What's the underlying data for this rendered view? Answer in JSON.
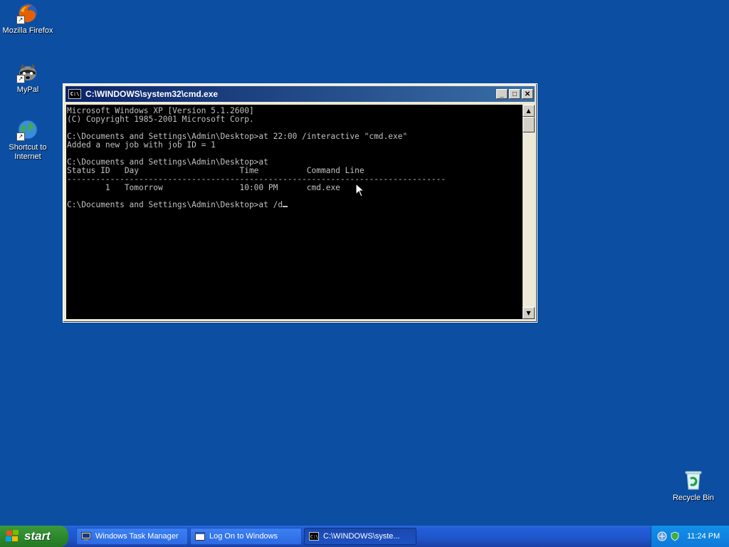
{
  "desktop": {
    "icons": [
      {
        "label": "Mozilla Firefox"
      },
      {
        "label": "MyPal"
      },
      {
        "label": "Shortcut to Internet"
      },
      {
        "label": "Recycle Bin"
      }
    ]
  },
  "cmd": {
    "title": "C:\\WINDOWS\\system32\\cmd.exe",
    "icon_text": "C:\\",
    "buttons": {
      "minimize": "_",
      "maximize": "□",
      "close": "✕"
    },
    "lines": [
      "Microsoft Windows XP [Version 5.1.2600]",
      "(C) Copyright 1985-2001 Microsoft Corp.",
      "",
      "C:\\Documents and Settings\\Admin\\Desktop>at 22:00 /interactive \"cmd.exe\"",
      "Added a new job with job ID = 1",
      "",
      "C:\\Documents and Settings\\Admin\\Desktop>at",
      "Status ID   Day                     Time          Command Line",
      "-------------------------------------------------------------------------------",
      "        1   Tomorrow                10:00 PM      cmd.exe",
      "",
      "C:\\Documents and Settings\\Admin\\Desktop>at /d"
    ]
  },
  "taskbar": {
    "start_label": "start",
    "tasks": [
      {
        "label": "Windows Task Manager"
      },
      {
        "label": "Log On to Windows"
      },
      {
        "label": "C:\\WINDOWS\\syste..."
      }
    ],
    "clock": "11:24 PM"
  },
  "icons": {
    "firefox": "firefox-icon",
    "mypal": "raccoon-icon",
    "internet": "globe-icon",
    "recycle": "recycle-bin-icon"
  },
  "colors": {
    "desktop": "#0b4ea2",
    "console_bg": "#000000",
    "console_fg": "#c0c0c0"
  }
}
